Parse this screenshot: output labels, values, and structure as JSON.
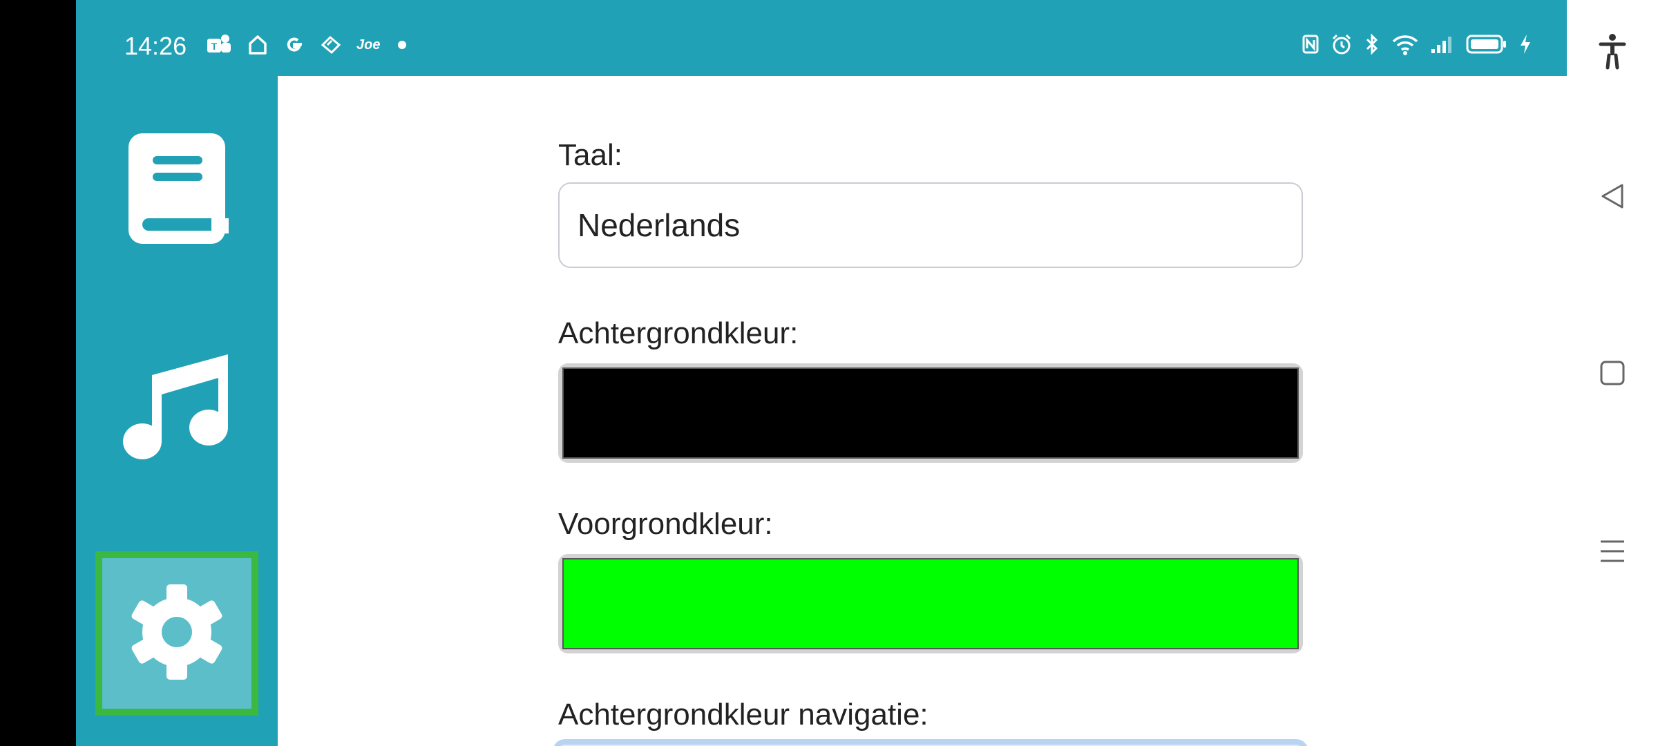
{
  "status_bar": {
    "time": "14:26",
    "left_icons": [
      "teams-icon",
      "home-icon",
      "google-icon",
      "tag-icon",
      "joe-icon",
      "dot-icon"
    ],
    "joe_text": "Joe",
    "right_icons": [
      "nfc-icon",
      "alarm-icon",
      "bluetooth-icon",
      "wifi-icon",
      "signal-icon",
      "battery-icon",
      "charging-icon"
    ]
  },
  "sidebar": {
    "items": [
      {
        "name": "book",
        "icon": "book-icon",
        "active": false
      },
      {
        "name": "music",
        "icon": "music-note-icon",
        "active": false
      },
      {
        "name": "settings",
        "icon": "gear-icon",
        "active": true
      }
    ],
    "active_border_color": "#3bb83f"
  },
  "settings": {
    "language": {
      "label": "Taal:",
      "value": "Nederlands"
    },
    "background_color": {
      "label": "Achtergrondkleur:",
      "value": "#000000"
    },
    "foreground_color": {
      "label": "Voorgrondkleur:",
      "value": "#00ff00"
    },
    "nav_background_color": {
      "label": "Achtergrondkleur navigatie:"
    }
  },
  "theme": {
    "accent": "#21a1b5",
    "active_tile": "#5bbec9"
  },
  "system_nav": {
    "icons": [
      "accessibility-icon",
      "back-icon",
      "home-square-icon",
      "recents-icon"
    ]
  }
}
